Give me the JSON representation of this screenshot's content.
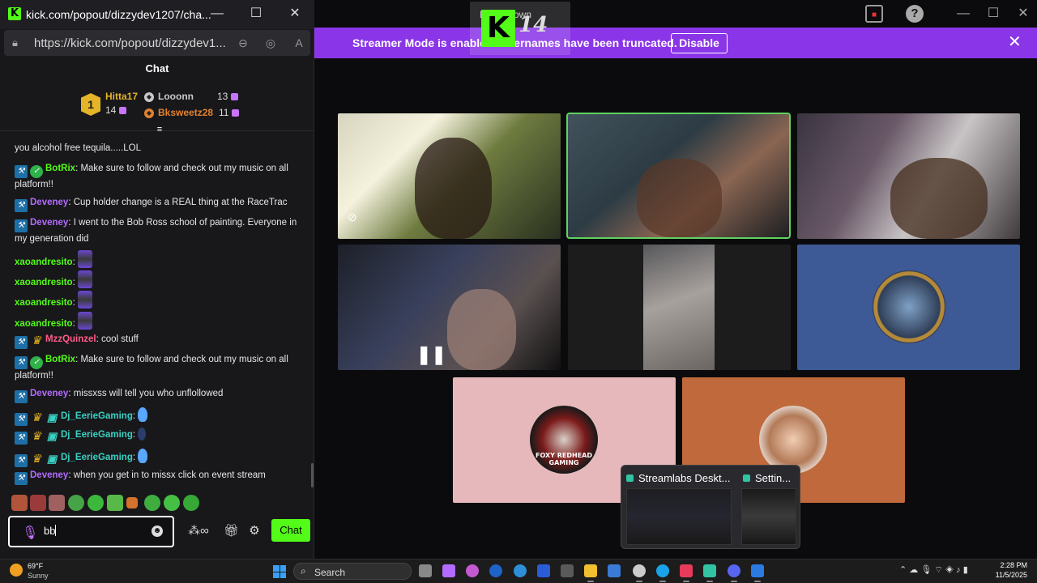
{
  "main": {
    "tab_text": "MuttaBrown",
    "tab_number": "14",
    "banner": {
      "text": "Streamer Mode is enabled. Usernames have been truncated.",
      "disable_label": "Disable"
    }
  },
  "preview": {
    "app1": "Streamlabs Deskt...",
    "app2": "Settin..."
  },
  "tiles": {
    "foxy_text": "FOXY REDHEAD GAMING"
  },
  "chat_window": {
    "title": "kick.com/popout/dizzydev1207/cha...",
    "url": "https://kick.com/popout/dizzydev1...",
    "header": "Chat",
    "leaderboard": {
      "rank": "1",
      "entries": [
        {
          "name": "Hitta17",
          "count": "14",
          "color": "#e4b429"
        },
        {
          "name": "Looonn",
          "count": "13",
          "color": "#c9c9c9"
        },
        {
          "name": "Bksweetz28",
          "count": "11",
          "color": "#e2822c"
        }
      ]
    },
    "messages": [
      {
        "text": "you alcohol free tequila.....LOL"
      },
      {
        "user": "BotRix",
        "color": "#53fc18",
        "text": ": Make sure to follow and check out my music on all platform!!"
      },
      {
        "user": "Deveney",
        "color": "#b36bff",
        "text": ": Cup holder change is a REAL thing at the RaceTrac"
      },
      {
        "user": "Deveney",
        "color": "#b36bff",
        "text": ": I went to the Bob Ross school of painting. Everyone in my generation did"
      },
      {
        "user": "xaoandresito",
        "color": "#53fc18",
        "text": ":"
      },
      {
        "user": "xaoandresito",
        "color": "#53fc18",
        "text": ":"
      },
      {
        "user": "xaoandresito",
        "color": "#53fc18",
        "text": ":"
      },
      {
        "user": "xaoandresito",
        "color": "#53fc18",
        "text": ":"
      },
      {
        "user": "MzzQuinzel",
        "color": "#ff5c8a",
        "text": ": cool stuff"
      },
      {
        "user": "BotRix",
        "color": "#53fc18",
        "text": ": Make sure to follow and check out my music on all platform!!"
      },
      {
        "user": "Deveney",
        "color": "#b36bff",
        "text": ": missxss will tell you who unflollowed"
      },
      {
        "user": "Dj_EerieGaming",
        "color": "#3ad0c2",
        "text": ":"
      },
      {
        "user": "Dj_EerieGaming",
        "color": "#3ad0c2",
        "text": ":"
      },
      {
        "user": "Dj_EerieGaming",
        "color": "#3ad0c2",
        "text": ":"
      },
      {
        "user": "Deveney",
        "color": "#b36bff",
        "text": ": when you get in to missx click on event stream"
      }
    ],
    "input_value": "bb",
    "send_label": "Chat"
  },
  "taskbar": {
    "weather_temp": "69°F",
    "weather_desc": "Sunny",
    "search_placeholder": "Search",
    "clock_time": "2:28 PM",
    "clock_date": "11/5/2025"
  },
  "icons": [
    "kick-logo-icon",
    "minimize-icon",
    "maximize-icon",
    "close-icon",
    "lock-icon",
    "zoom-icon",
    "eye-slash-icon",
    "read-aloud-icon",
    "mic-icon",
    "emoji-icon",
    "gift-icon",
    "settings-icon",
    "search-icon",
    "help-icon"
  ]
}
